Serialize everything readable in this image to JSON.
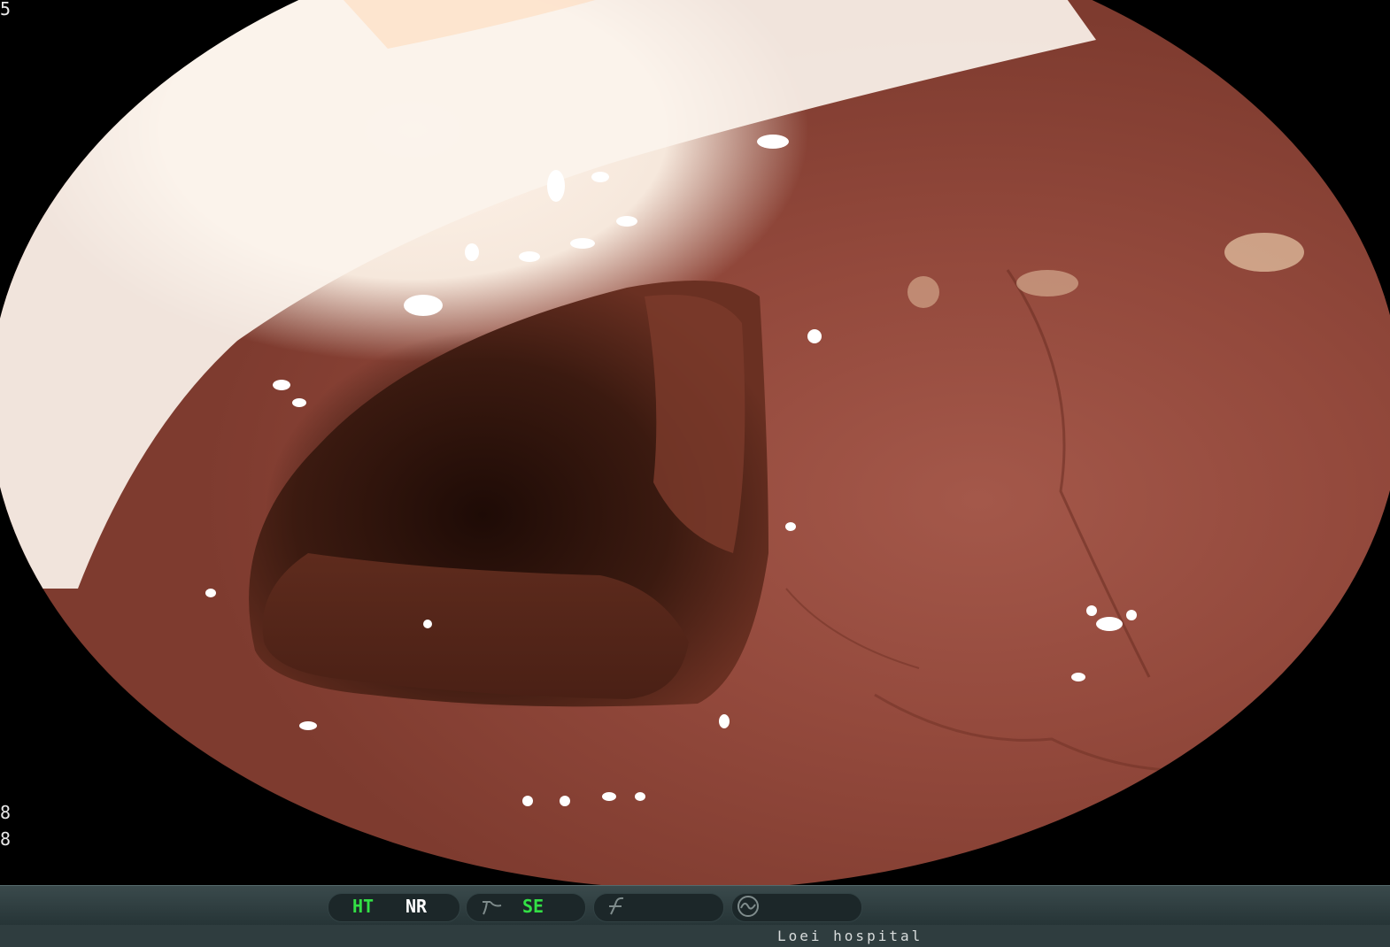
{
  "edge_text": {
    "top": "5",
    "bottom_1": "8",
    "bottom_2": "8"
  },
  "status_bar": {
    "mode_1": "HT",
    "mode_2": "NR",
    "mode_3": "SE",
    "icon_1": "scope-curve-icon",
    "icon_2": "slash-f-icon",
    "icon_3": "waveform-circle-icon"
  },
  "footer": {
    "institution": "Loei hospital"
  },
  "colors": {
    "active_mode": "#33e045",
    "inactive_mode": "#ffffff",
    "bar_bg": "#263436"
  }
}
